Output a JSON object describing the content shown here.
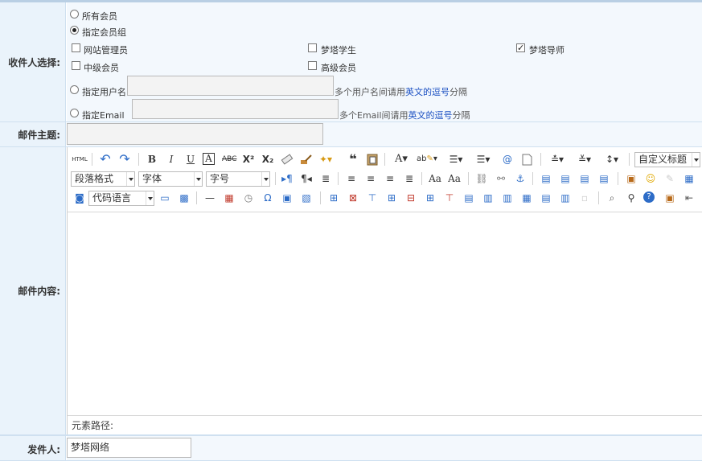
{
  "recipients": {
    "label": "收件人选择:",
    "radio_all": "所有会员",
    "radio_group": "指定会员组",
    "groups": [
      {
        "label": "网站管理员",
        "checked": false
      },
      {
        "label": "梦塔学生",
        "checked": false
      },
      {
        "label": "梦塔导师",
        "checked": true
      },
      {
        "label": "中级会员",
        "checked": false
      },
      {
        "label": "高级会员",
        "checked": false
      }
    ],
    "radio_username": "指定用户名",
    "username_hint_a": "多个用户名间请用",
    "username_hint_b": "英文的逗号",
    "username_hint_c": "分隔",
    "radio_email": "指定Email",
    "email_hint_a": "多个Email间请用",
    "email_hint_b": "英文的逗号",
    "email_hint_c": "分隔",
    "selected": "group"
  },
  "subject": {
    "label": "邮件主题:",
    "value": ""
  },
  "content": {
    "label": "邮件内容:",
    "selects": {
      "custom_title": "自定义标题",
      "paragraph": "段落格式",
      "font": "字体",
      "size": "字号",
      "code_lang": "代码语言"
    },
    "html_button": "HTML",
    "path_label": "元素路径:"
  },
  "sender": {
    "label": "发件人:",
    "value": "梦塔网络"
  },
  "colors": {
    "label_bg": "#eaf3fb",
    "value_bg": "#f3f8fd",
    "border": "#cfe0f0",
    "link_blue": "#1a4fc2"
  }
}
